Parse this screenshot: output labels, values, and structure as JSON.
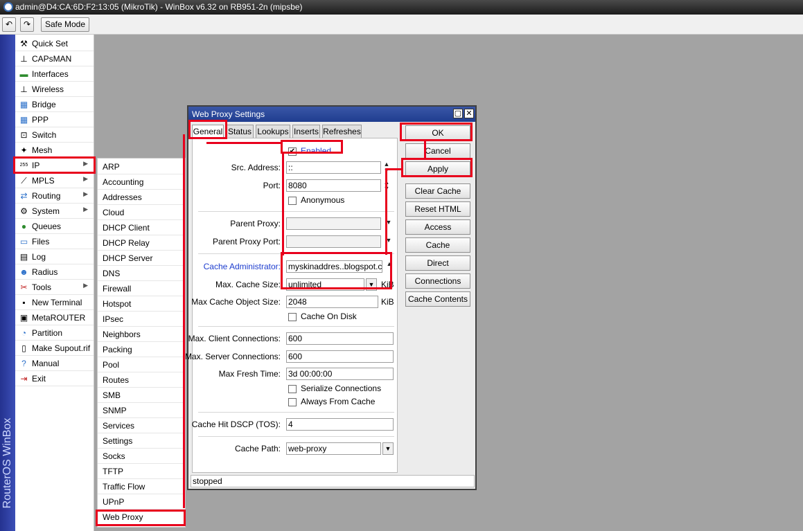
{
  "window": {
    "title": "admin@D4:CA:6D:F2:13:05 (MikroTik) - WinBox v6.32 on RB951-2n (mipsbe)"
  },
  "toolbar": {
    "undo_icon": "↶",
    "redo_icon": "↷",
    "safe_mode_label": "Safe Mode"
  },
  "sidebar": {
    "brand": "RouterOS WinBox",
    "items": [
      {
        "label": "Quick Set",
        "icon": "⚒"
      },
      {
        "label": "CAPsMAN",
        "icon": "⊥"
      },
      {
        "label": "Interfaces",
        "icon": "▬"
      },
      {
        "label": "Wireless",
        "icon": "⊥"
      },
      {
        "label": "Bridge",
        "icon": "▦"
      },
      {
        "label": "PPP",
        "icon": "▦"
      },
      {
        "label": "Switch",
        "icon": "⊡"
      },
      {
        "label": "Mesh",
        "icon": "✦"
      },
      {
        "label": "IP",
        "icon": "255"
      },
      {
        "label": "MPLS",
        "icon": "⟋"
      },
      {
        "label": "Routing",
        "icon": "⇄"
      },
      {
        "label": "System",
        "icon": "⚙"
      },
      {
        "label": "Queues",
        "icon": "●"
      },
      {
        "label": "Files",
        "icon": "▭"
      },
      {
        "label": "Log",
        "icon": "▤"
      },
      {
        "label": "Radius",
        "icon": "☻"
      },
      {
        "label": "Tools",
        "icon": "✂"
      },
      {
        "label": "New Terminal",
        "icon": "▪"
      },
      {
        "label": "MetaROUTER",
        "icon": "▣"
      },
      {
        "label": "Partition",
        "icon": "◔"
      },
      {
        "label": "Make Supout.rif",
        "icon": "▯"
      },
      {
        "label": "Manual",
        "icon": "?"
      },
      {
        "label": "Exit",
        "icon": "⇥"
      }
    ],
    "submenu_arrow": "▶"
  },
  "ip_submenu": {
    "items": [
      "ARP",
      "Accounting",
      "Addresses",
      "Cloud",
      "DHCP Client",
      "DHCP Relay",
      "DHCP Server",
      "DNS",
      "Firewall",
      "Hotspot",
      "IPsec",
      "Neighbors",
      "Packing",
      "Pool",
      "Routes",
      "SMB",
      "SNMP",
      "Services",
      "Settings",
      "Socks",
      "TFTP",
      "Traffic Flow",
      "UPnP",
      "Web Proxy"
    ]
  },
  "dialog": {
    "title": "Web Proxy Settings",
    "restore_icon": "▢",
    "close_icon": "✕",
    "tabs": [
      "General",
      "Status",
      "Lookups",
      "Inserts",
      "Refreshes"
    ],
    "enabled_label": "Enabled",
    "enabled_check": "✔",
    "src_address_label": "Src. Address:",
    "src_address_value": "::",
    "port_label": "Port:",
    "port_value": "8080",
    "anonymous_label": "Anonymous",
    "parent_proxy_label": "Parent Proxy:",
    "parent_proxy_port_label": "Parent Proxy Port:",
    "cache_admin_label": "Cache Administrator:",
    "cache_admin_value": "myskinaddres..blogspot.com",
    "max_cache_size_label": "Max. Cache Size:",
    "max_cache_size_value": "unlimited",
    "max_cache_object_label": "Max Cache Object Size:",
    "max_cache_object_value": "2048",
    "kib": "KiB",
    "cache_on_disk_label": "Cache On Disk",
    "max_client_label": "Max. Client Connections:",
    "max_client_value": "600",
    "max_server_label": "Max. Server Connections:",
    "max_server_value": "600",
    "max_fresh_label": "Max Fresh Time:",
    "max_fresh_value": "3d 00:00:00",
    "serialize_label": "Serialize Connections",
    "always_cache_label": "Always From Cache",
    "dscp_label": "Cache Hit DSCP (TOS):",
    "dscp_value": "4",
    "cache_path_label": "Cache Path:",
    "cache_path_value": "web-proxy",
    "buttons": [
      "OK",
      "Cancel",
      "Apply",
      "Clear Cache",
      "Reset HTML",
      "Access",
      "Cache",
      "Direct",
      "Connections",
      "Cache Contents"
    ],
    "status": "stopped",
    "spin_up": "▲",
    "spin_down": "▼",
    "dropdown_icon": "▼"
  },
  "colors": {
    "highlight": "#e8001c",
    "titlebar": "#1f3d8f",
    "link_label": "#1c3cce"
  }
}
